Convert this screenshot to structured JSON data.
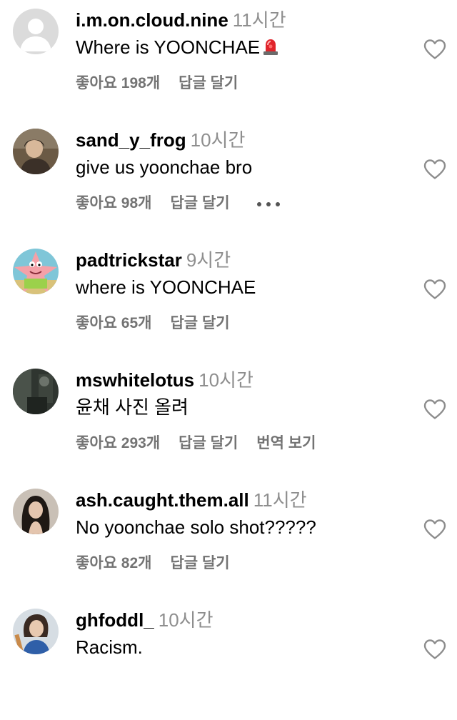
{
  "comments": [
    {
      "username": "i.m.on.cloud.nine",
      "time": "11시간",
      "text": "Where is YOONCHAE",
      "emoji": "rotating-light-emoji",
      "likes": "좋아요 198개",
      "reply": "답글 달기",
      "avatar": "default-avatar"
    },
    {
      "username": "sand_y_frog",
      "time": "10시간",
      "text": "give us yoonchae bro",
      "likes": "좋아요 98개",
      "reply": "답글 달기",
      "more": "more-options-icon",
      "avatar": "photo-avatar"
    },
    {
      "username": "padtrickstar",
      "time": "9시간",
      "text": "where is YOONCHAE",
      "likes": "좋아요 65개",
      "reply": "답글 달기",
      "avatar": "patrick-star-avatar"
    },
    {
      "username": "mswhitelotus",
      "time": "10시간",
      "text": "윤채 사진 올려",
      "likes": "좋아요 293개",
      "reply": "답글 달기",
      "translate": "번역 보기",
      "avatar": "photo-avatar"
    },
    {
      "username": "ash.caught.them.all",
      "time": "11시간",
      "text": "No yoonchae solo shot?????",
      "likes": "좋아요 82개",
      "reply": "답글 달기",
      "avatar": "photo-avatar"
    },
    {
      "username": "ghfoddl_",
      "time": "10시간",
      "text": "Racism.",
      "avatar": "photo-avatar"
    }
  ],
  "colors": {
    "text": "#000000",
    "muted": "#8e8e8e",
    "action": "#737373",
    "heart_outline": "#8e8e8e"
  }
}
